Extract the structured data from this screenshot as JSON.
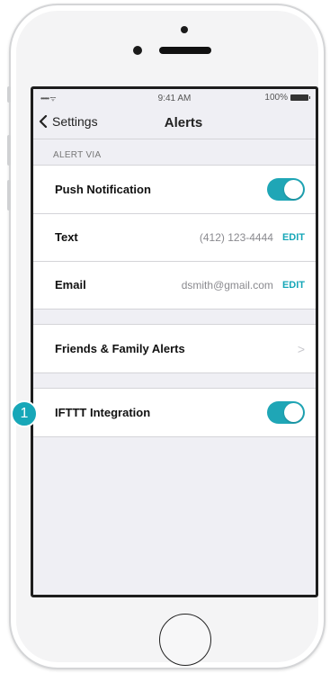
{
  "status_bar": {
    "signal": "••••• ᯤ",
    "time": "9:41 AM",
    "battery": "100%"
  },
  "nav": {
    "back_label": "Settings",
    "title": "Alerts"
  },
  "alert_via": {
    "header": "ALERT VIA",
    "push": {
      "label": "Push Notification",
      "enabled": true
    },
    "text": {
      "label": "Text",
      "value": "(412) 123-4444",
      "edit": "EDIT"
    },
    "email": {
      "label": "Email",
      "value": "dsmith@gmail.com",
      "edit": "EDIT"
    }
  },
  "friends": {
    "label": "Friends & Family Alerts",
    "chevron": ">"
  },
  "ifttt": {
    "label": "IFTTT Integration",
    "enabled": true
  },
  "callout": {
    "number": "1"
  },
  "colors": {
    "accent": "#17a7b8",
    "toggle_on": "#1fa6b6",
    "background": "#efeff4"
  }
}
